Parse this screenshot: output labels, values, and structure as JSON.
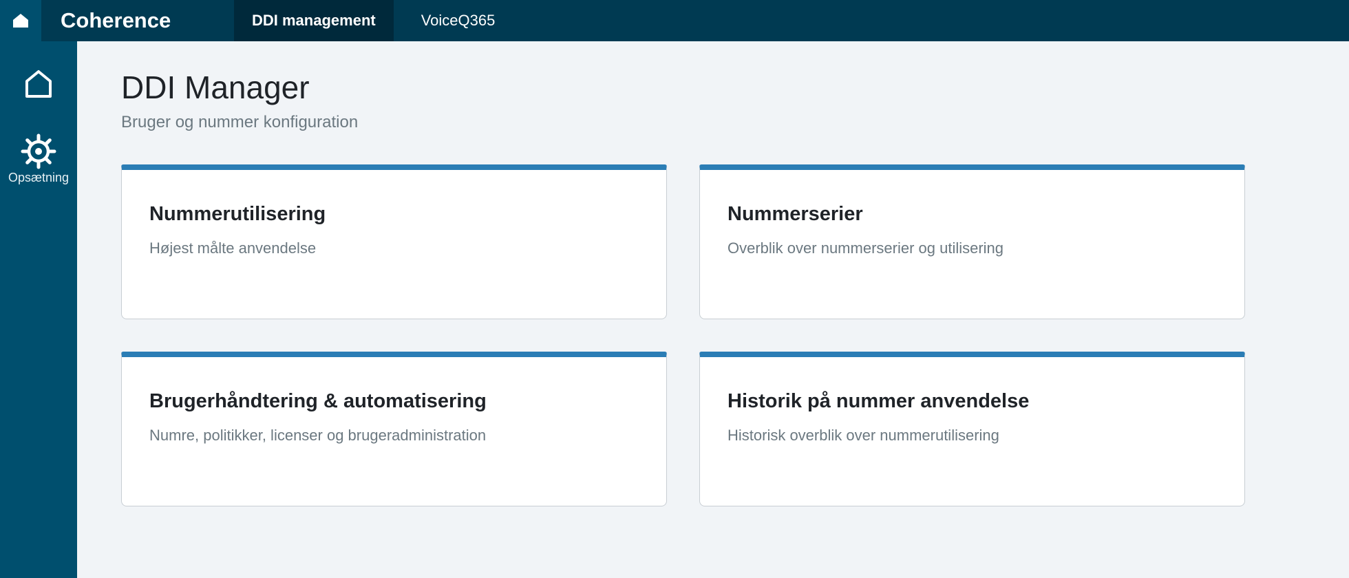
{
  "topbar": {
    "home_icon": "home-icon",
    "brand": "Coherence",
    "tabs": [
      {
        "label": "DDI management",
        "active": true
      },
      {
        "label": "VoiceQ365",
        "active": false
      }
    ],
    "background": "#003a52"
  },
  "sidebar": {
    "items": [
      {
        "icon": "home-outline-icon",
        "label": ""
      },
      {
        "icon": "gear-icon",
        "label": "Opsætning"
      }
    ],
    "background": "#004f6e"
  },
  "main": {
    "title": "DDI Manager",
    "subtitle": "Bruger og nummer konfiguration",
    "cards": [
      {
        "title": "Nummerutilisering",
        "description": "Højest målte anvendelse"
      },
      {
        "title": "Nummerserier",
        "description": "Overblik over nummerserier og utilisering"
      },
      {
        "title": "Brugerhåndtering & automatisering",
        "description": "Numre, politikker, licenser og brugeradministration"
      },
      {
        "title": "Historik på nummer anvendelse",
        "description": "Historisk overblik over nummerutilisering"
      }
    ],
    "accent": "#2b7db5"
  }
}
